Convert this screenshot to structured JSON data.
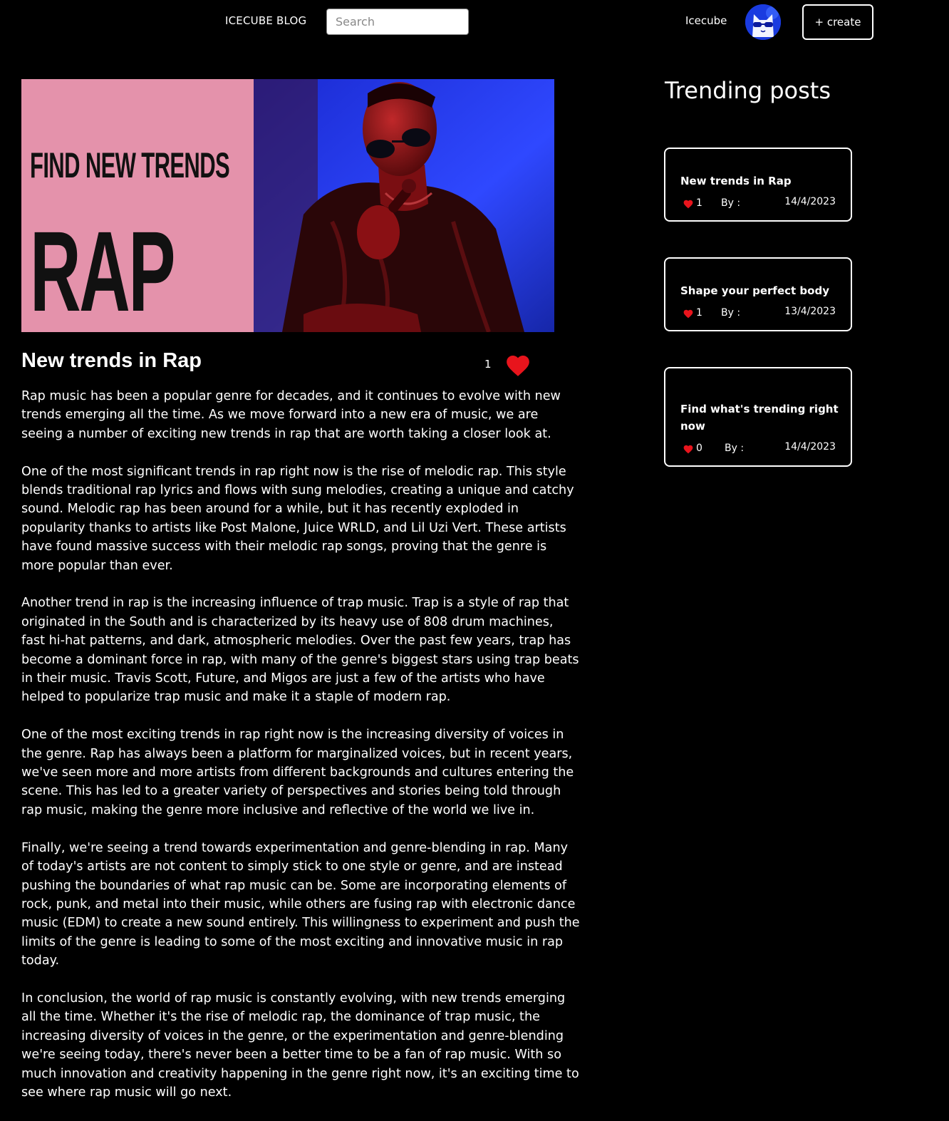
{
  "header": {
    "brand": "ICECUBE BLOG",
    "search_placeholder": "Search",
    "username": "Icecube",
    "create_label": "+ create"
  },
  "hero": {
    "tagline": "FIND NEW TRENDS",
    "word": "RAP"
  },
  "post": {
    "title": "New trends in Rap",
    "likes": "1",
    "paragraphs": [
      "Rap music has been a popular genre for decades, and it continues to evolve with new trends emerging all the time. As we move forward into a new era of music, we are seeing a number of exciting new trends in rap that are worth taking a closer look at.",
      "One of the most significant trends in rap right now is the rise of melodic rap. This style blends traditional rap lyrics and flows with sung melodies, creating a unique and catchy sound. Melodic rap has been around for a while, but it has recently exploded in popularity thanks to artists like Post Malone, Juice WRLD, and Lil Uzi Vert. These artists have found massive success with their melodic rap songs, proving that the genre is more popular than ever.",
      "Another trend in rap is the increasing influence of trap music. Trap is a style of rap that originated in the South and is characterized by its heavy use of 808 drum machines, fast hi-hat patterns, and dark, atmospheric melodies. Over the past few years, trap has become a dominant force in rap, with many of the genre's biggest stars using trap beats in their music. Travis Scott, Future, and Migos are just a few of the artists who have helped to popularize trap music and make it a staple of modern rap.",
      "One of the most exciting trends in rap right now is the increasing diversity of voices in the genre. Rap has always been a platform for marginalized voices, but in recent years, we've seen more and more artists from different backgrounds and cultures entering the scene. This has led to a greater variety of perspectives and stories being told through rap music, making the genre more inclusive and reflective of the world we live in.",
      "Finally, we're seeing a trend towards experimentation and genre-blending in rap. Many of today's artists are not content to simply stick to one style or genre, and are instead pushing the boundaries of what rap music can be. Some are incorporating elements of rock, punk, and metal into their music, while others are fusing rap with electronic dance music (EDM) to create a new sound entirely. This willingness to experiment and push the limits of the genre is leading to some of the most exciting and innovative music in rap today.",
      "In conclusion, the world of rap music is constantly evolving, with new trends emerging all the time. Whether it's the rise of melodic rap, the dominance of trap music, the increasing diversity of voices in the genre, or the experimentation and genre-blending we're seeing today, there's never been a better time to be a fan of rap music. With so much innovation and creativity happening in the genre right now, it's an exciting time to see where rap music will go next."
    ]
  },
  "sidebar": {
    "title": "Trending posts",
    "cards": [
      {
        "title": "New trends in Rap",
        "likes": "1",
        "by": "By :",
        "date": "14/4/2023"
      },
      {
        "title": "Shape your perfect body",
        "likes": "1",
        "by": "By :",
        "date": "13/4/2023"
      },
      {
        "title": "Find what's trending right now",
        "likes": "0",
        "by": "By :",
        "date": "14/4/2023"
      }
    ]
  },
  "colors": {
    "background": "#000000",
    "heart": "#e8141c",
    "hero_pink": "#e492ab",
    "avatar_blue": "#1a3be0"
  },
  "icons": {
    "like": "heart-icon",
    "avatar": "cat-avatar-icon"
  }
}
